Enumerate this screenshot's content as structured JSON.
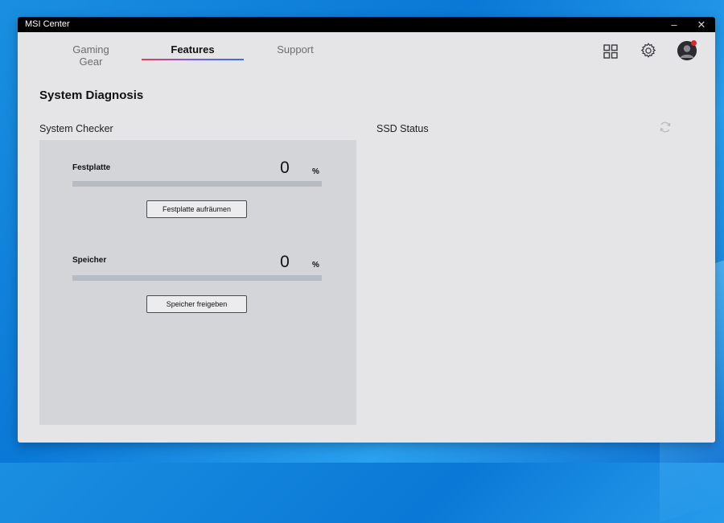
{
  "window": {
    "title": "MSI Center",
    "minimize": "–",
    "close": "✕"
  },
  "tabs": [
    {
      "label": "Gaming Gear",
      "active": false
    },
    {
      "label": "Features",
      "active": true
    },
    {
      "label": "Support",
      "active": false
    }
  ],
  "header_icons": [
    "apps-grid-icon",
    "gear-icon",
    "user-avatar"
  ],
  "page_title": "System Diagnosis",
  "system_checker": {
    "label": "System Checker",
    "items": [
      {
        "name": "Festplatte",
        "percent": "0",
        "unit": "%",
        "progress": 0,
        "button": "Festplatte aufräumen"
      },
      {
        "name": "Speicher",
        "percent": "0",
        "unit": "%",
        "progress": 0,
        "button": "Speicher freigeben"
      }
    ]
  },
  "ssd_status": {
    "label": "SSD Status",
    "refresh_icon": "refresh-icon"
  },
  "colors": {
    "titlebar": "#000000",
    "accent_gradient": [
      "#e0405a",
      "#3d6fe0"
    ],
    "notify": "#e0262c"
  }
}
